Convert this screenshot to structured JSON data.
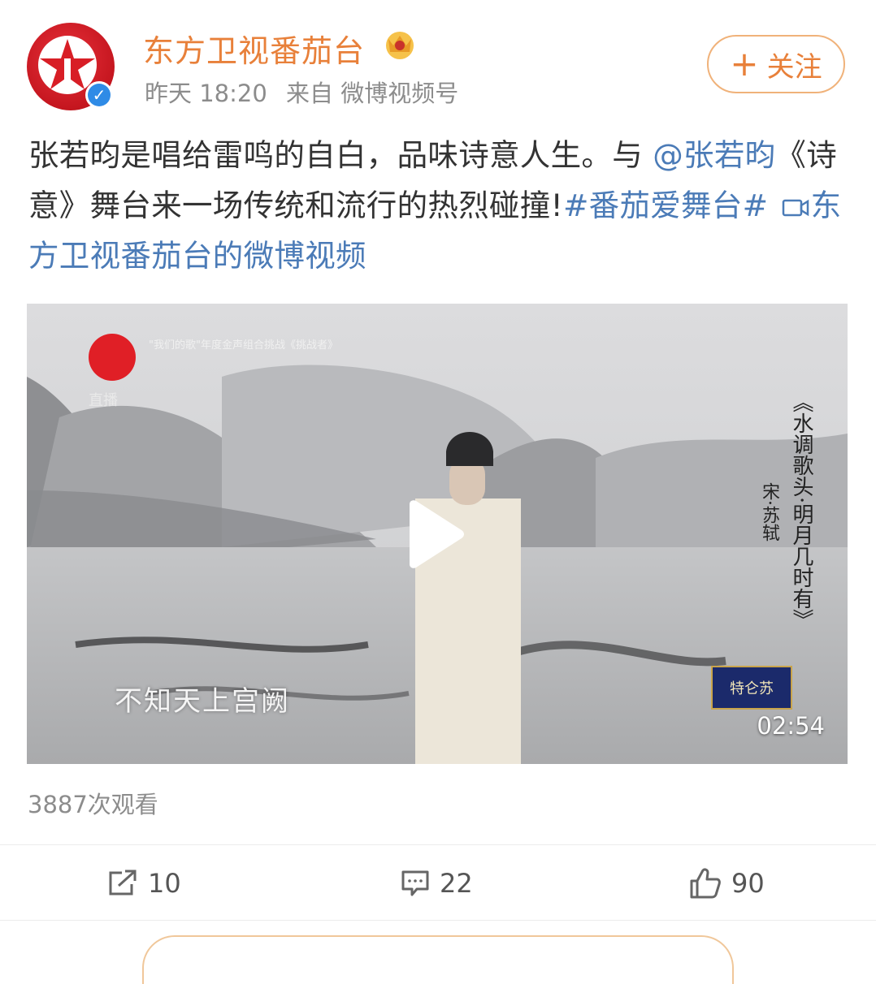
{
  "post": {
    "username": "东方卫视番茄台",
    "time": "昨天 18:20",
    "source": "来自 微博视频号",
    "follow_label": "关注",
    "text_plain": "张若昀是唱给雷鸣的自白，品味诗意人生。与 ",
    "mention": "@张若昀",
    "text_middle": "《诗意》舞台来一场传统和流行的热烈碰撞!",
    "hashtag": "#番茄爱舞台#",
    "video_link": "东方卫视番茄台的微博视频"
  },
  "video": {
    "overlay_caption": "\"我们的歌\"年度金声组合挑战《挑战者》",
    "live_text": "直播",
    "vertical_title": "《水调歌头·明月几时有》",
    "vertical_author": "宋·苏轼",
    "lyric": "不知天上宫阙",
    "sponsor": "特仑苏",
    "duration": "02:54"
  },
  "stats": {
    "views": "3887次观看",
    "reposts": "10",
    "comments": "22",
    "likes": "90"
  },
  "colors": {
    "username": "#e8803a",
    "link": "#4b7bb7",
    "meta": "#8c8c8c"
  },
  "icons": [
    "verified-icon",
    "crown-icon",
    "plus-icon",
    "video-link-icon",
    "play-icon",
    "repost-icon",
    "comment-icon",
    "like-icon"
  ]
}
